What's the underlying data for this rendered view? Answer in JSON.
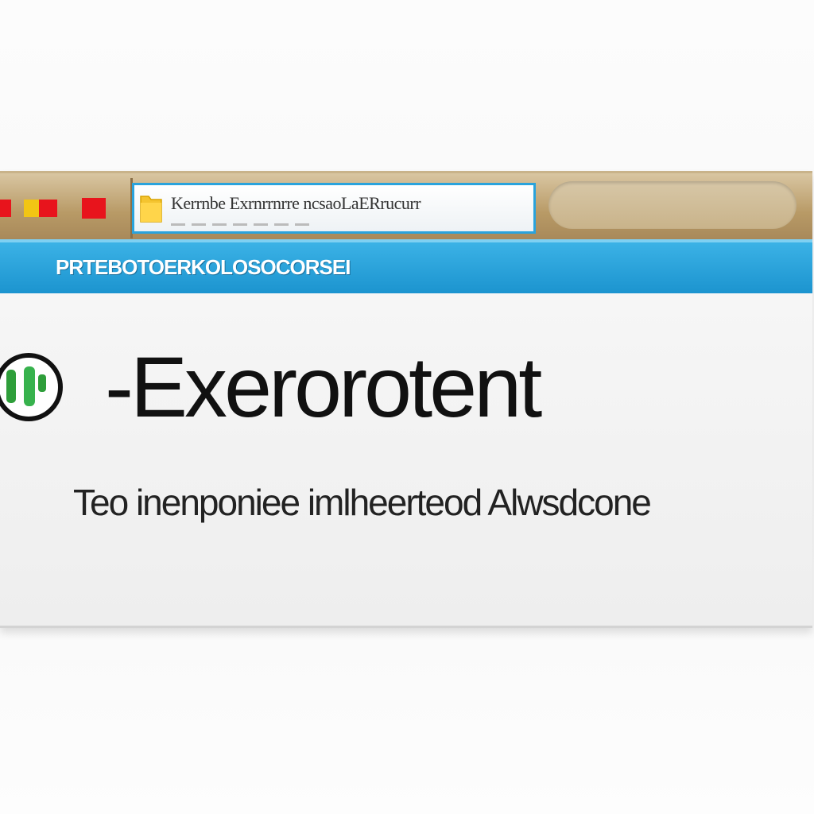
{
  "window": {
    "controls": [
      "close",
      "minimize",
      "maximize"
    ],
    "address": {
      "text": "Kerrnbe Exrnrrnrre ncsaoLaERrucurr",
      "icon": "folder-icon"
    },
    "search": {
      "placeholder": ""
    }
  },
  "menubar": {
    "label": "PRTEBOTOERKOLOSOCORSEI"
  },
  "content": {
    "icon": "status-check-icon",
    "heading": "-Exerorotent",
    "subtext": "Teo inenponiee imlheerteod Alwsdcone"
  },
  "colors": {
    "accent": "#1c94cf",
    "titlebar": "#b89a66",
    "close": "#e8141c",
    "minimize": "#f2c514",
    "status": "#2e9e3a"
  }
}
